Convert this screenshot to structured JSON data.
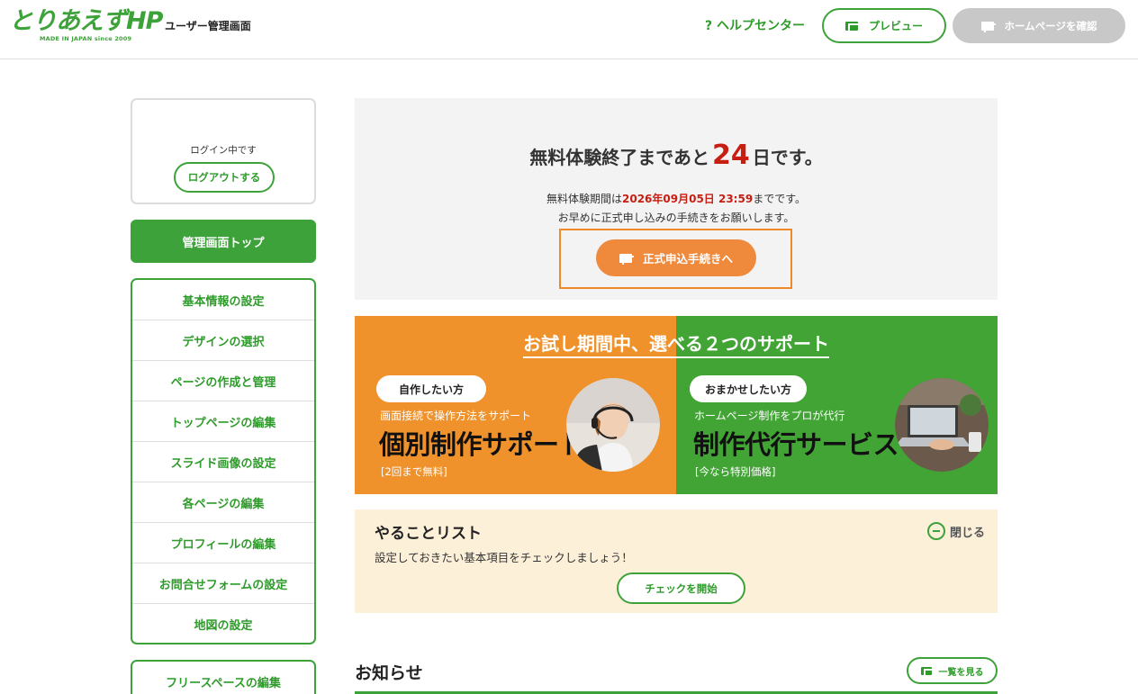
{
  "header": {
    "logo_text": "とりあえずHP",
    "logo_tagline": "MADE IN JAPAN since 2009",
    "screen_title": "ユーザー管理画面",
    "help_label": "? ヘルプセンター",
    "preview_label": "プレビュー",
    "homepage_label": "ホームページを確認"
  },
  "sidebar": {
    "login_status": "ログイン中です",
    "logout_label": "ログアウトする",
    "admin_top_label": "管理画面トップ",
    "items": [
      {
        "label": "基本情報の設定"
      },
      {
        "label": "デザインの選択"
      },
      {
        "label": "ページの作成と管理"
      },
      {
        "label": "トップページの編集"
      },
      {
        "label": "スライド画像の設定"
      },
      {
        "label": "各ページの編集"
      },
      {
        "label": "プロフィールの編集"
      },
      {
        "label": "お問合せフォームの設定"
      },
      {
        "label": "地図の設定"
      }
    ],
    "free_space_label": "フリースペースの編集"
  },
  "trial": {
    "title_prefix": "無料体験終了まであと",
    "days_left": "24",
    "title_suffix": "日です。",
    "period_prefix": "無料体験期間は",
    "deadline": "2026年09月05日 23:59",
    "period_suffix": "までです。",
    "request_text": "お早めに正式申し込みの手続きをお願いします。",
    "apply_label": "正式申込手続きへ"
  },
  "support": {
    "title": "お試し期間中、選べる２つのサポート",
    "left": {
      "pill": "自作したい方",
      "subtitle": "画面接続で操作方法をサポート",
      "name": "個別制作サポート",
      "note": "[2回まで無料]"
    },
    "right": {
      "pill": "おまかせしたい方",
      "subtitle": "ホームページ制作をプロが代行",
      "name": "制作代行サービス",
      "note": "[今なら特別価格]"
    }
  },
  "todo": {
    "title": "やることリスト",
    "description": "設定しておきたい基本項目をチェックしましょう！",
    "close_label": "閉じる",
    "start_label": "チェックを開始"
  },
  "news": {
    "title": "お知らせ",
    "view_all_label": "一覧を見る"
  },
  "colors": {
    "brand_green": "#3ea23a",
    "accent_orange": "#ef8a3c",
    "alert_red": "#c81e12"
  }
}
